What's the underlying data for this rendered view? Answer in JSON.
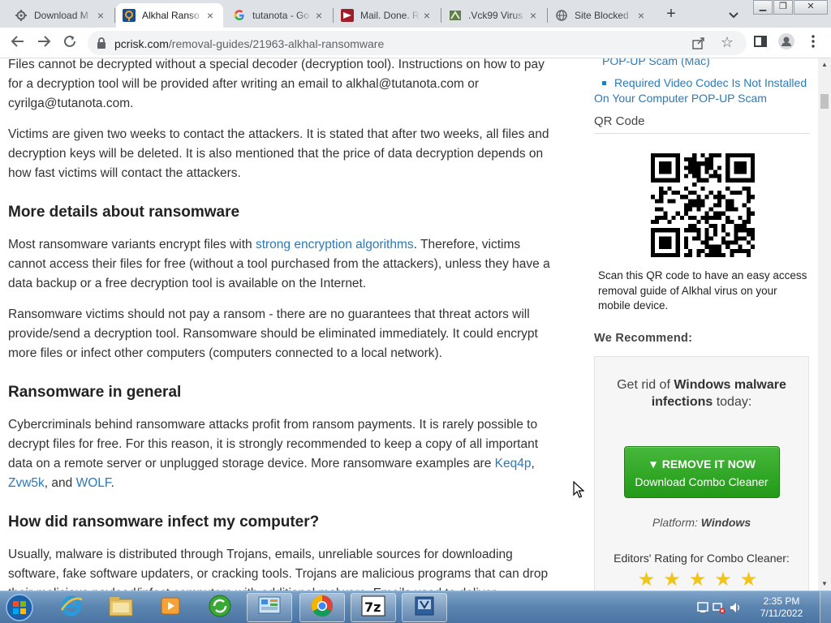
{
  "browser": {
    "tabs": [
      {
        "title": "Download M",
        "icon": "gear-icon",
        "active": false
      },
      {
        "title": "Alkhal Ranso",
        "icon": "pcrisk-icon",
        "active": true
      },
      {
        "title": "tutanota - Go",
        "icon": "google-icon",
        "active": false
      },
      {
        "title": "Mail. Done. R",
        "icon": "tutanota-icon",
        "active": false
      },
      {
        "title": ".Vck99 Virus",
        "icon": "virus-site-icon",
        "active": false
      },
      {
        "title": "Site Blocked",
        "icon": "globe-icon",
        "active": false
      }
    ],
    "new_tab_label": "+",
    "url_host": "pcrisk.com",
    "url_path": "/removal-guides/21963-alkhal-ransomware"
  },
  "article": {
    "p1_text": "Files cannot be decrypted without a special decoder (decryption tool). Instructions on how to pay for a decryption tool will be provided after writing an email to alkhal@tutanota.com or cyrilga@tutanota.com.",
    "p2_text": "Victims are given two weeks to contact the attackers. It is stated that after two weeks, all files and decryption keys will be deleted. It is also mentioned that the price of data decryption depends on how fast victims will contact the attackers.",
    "h_more": "More details about ransomware",
    "p3_before": "Most ransomware variants encrypt files with ",
    "p3_link": "strong encryption algorithms",
    "p3_after": ". Therefore, victims cannot access their files for free (without a tool purchased from the attackers), unless they have a data backup or a free decryption tool is available on the Internet.",
    "p4_text": "Ransomware victims should not pay a ransom - there are no guarantees that threat actors will provide/send a decryption tool. Ransomware should be eliminated immediately. It could encrypt more files or infect other computers (computers connected to a local network).",
    "h_general": "Ransomware in general",
    "p5_before": "Cybercriminals behind ransomware attacks profit from ransom payments. It is rarely possible to decrypt files for free. For this reason, it is strongly recommended to keep a copy of all important data on a remote server or unplugged storage device. More ransomware examples are ",
    "p5_link1": "Keq4p",
    "p5_sep1": ", ",
    "p5_link2": "Zvw5k",
    "p5_sep2": ", and ",
    "p5_link3": "WOLF",
    "p5_end": ".",
    "h_infect": "How did ransomware infect my computer?",
    "p6_text": "Usually, malware is distributed through Trojans, emails, unreliable sources for downloading software, fake software updaters, or cracking tools. Trojans are malicious programs that can drop their malicious payload/infect computers with additional malware. Emails used to deliver"
  },
  "sidebar": {
    "related": [
      {
        "label": "POP-UP Scam (Mac)",
        "bullet": false
      },
      {
        "label": "Required Video Codec Is Not Installed On Your Computer POP-UP Scam",
        "bullet": true
      }
    ],
    "qr_heading": "QR Code",
    "qr_text": "Scan this QR code to have an easy access removal guide of Alkhal virus on your mobile device.",
    "recommend_heading": "We Recommend:",
    "rec_lead_1": "Get rid of ",
    "rec_lead_bold": "Windows malware infections",
    "rec_lead_2": " today:",
    "button_line1": "▼ REMOVE IT NOW",
    "button_line2": "Download Combo Cleaner",
    "platform_label": "Platform: ",
    "platform_value": "Windows",
    "rating_label": "Editors' Rating for Combo Cleaner:",
    "stars": "★★★★★"
  },
  "taskbar": {
    "apps": [
      "internet-explorer-icon",
      "file-explorer-icon",
      "media-player-icon",
      "sync-center-icon",
      "control-panel-icon",
      "chrome-icon",
      "7zip-icon",
      "virtualbox-icon"
    ],
    "time": "2:35 PM",
    "date": "7/11/2022"
  },
  "colors": {
    "link": "#2a7ab8",
    "button_green": "#2faa22",
    "tabstrip_bg": "#dee1e6"
  }
}
